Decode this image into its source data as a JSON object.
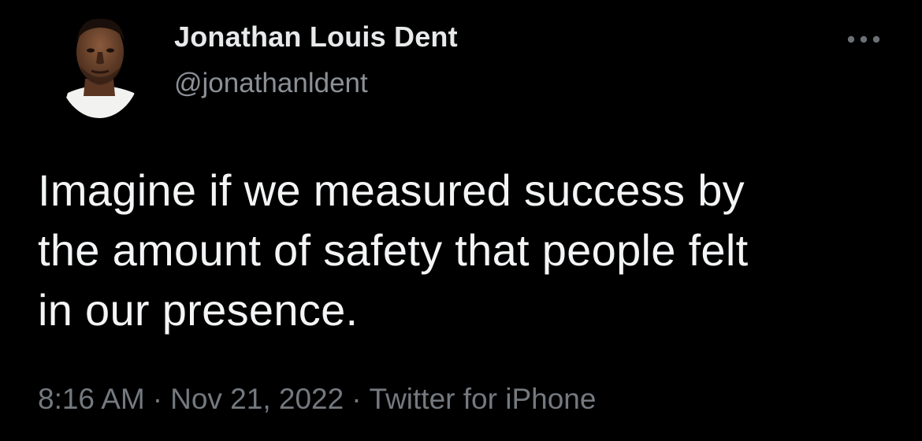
{
  "author": {
    "display_name": "Jonathan Louis Dent",
    "handle": "@jonathanldent",
    "avatar_icon": "profile-photo"
  },
  "actions": {
    "more_icon": "more-horizontal-icon"
  },
  "tweet": {
    "lines": [
      "Imagine if we measured success by",
      "the amount of safety that people felt",
      "in our presence."
    ]
  },
  "meta": {
    "time": "8:16 AM",
    "separator": "·",
    "date": "Nov 21, 2022",
    "source": "Twitter for iPhone"
  },
  "colors": {
    "background": "#000000",
    "primary_text": "#e7e9ea",
    "secondary_text": "#74797f"
  }
}
